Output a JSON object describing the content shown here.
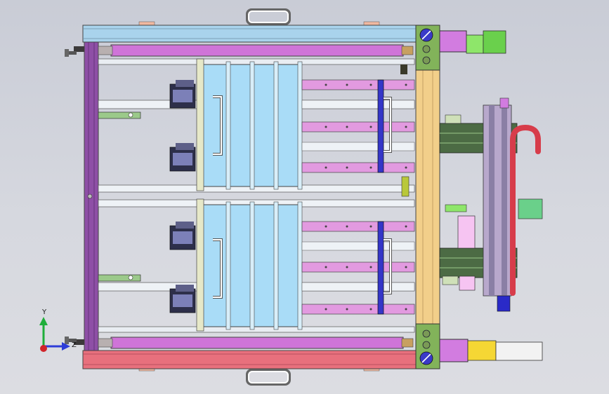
{
  "viewport": {
    "background_top": "#c9ccd6",
    "background_bottom": "#dcdde2"
  },
  "triad": {
    "y_label": "Y",
    "z_label": "Z",
    "y_color": "#1fae3a",
    "x_color": "#d0242a",
    "z_color": "#2d3dd8"
  },
  "colors": {
    "frame_top": "#a9d3ec",
    "frame_bottom": "#e8707d",
    "frame_left": "#8e4fa6",
    "column": "#f2cf8a",
    "cylinder": "#cf74d8",
    "rail_pink": "#e29ae0",
    "glass": "#a9dcf7",
    "strip_green": "#9bc98a",
    "blue_part": "#3436c8",
    "motor_purple": "#d27ce0",
    "motor_green": "#8ee66a",
    "motor_yellow": "#f5d734",
    "hook_red": "#d73c4a",
    "dark_green": "#4c6b44"
  }
}
